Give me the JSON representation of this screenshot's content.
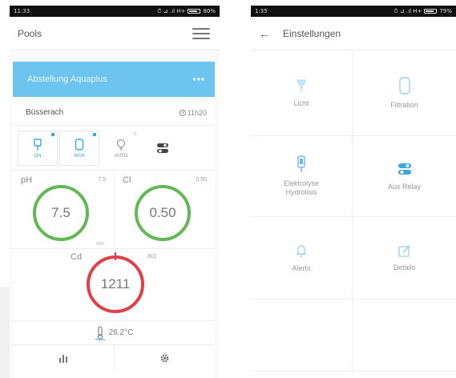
{
  "left_screen": {
    "status_bar": {
      "time": "11:33",
      "right": "⏱ ⊿ .ıl H+",
      "battery": "80%"
    },
    "app_bar": {
      "title": "Pools"
    },
    "banner": {
      "title": "Abstellung Aquaplus",
      "menu": "•••"
    },
    "pool": {
      "name": "Büsserach",
      "time": "11h20"
    },
    "toggles": [
      {
        "name": "light",
        "label": "ON",
        "active": true
      },
      {
        "name": "filtration",
        "label": "MAN",
        "active": true
      },
      {
        "name": "bulb",
        "label": "AUTO",
        "active": false,
        "indicator": "0"
      },
      {
        "name": "switch",
        "label": "",
        "active": false
      }
    ],
    "gauges": [
      {
        "name": "pH",
        "setpoint": "7.5",
        "value": "7.5",
        "sub": "OFF",
        "color": "#62b854"
      },
      {
        "name": "Cl",
        "setpoint": "0.50",
        "value": "0.50",
        "sub": "",
        "color": "#62b854"
      }
    ],
    "cd": {
      "name": "Cd",
      "setpoint": "801",
      "value": "1211",
      "color": "#e0404a"
    },
    "temperature": "26.2°C"
  },
  "right_screen": {
    "status_bar": {
      "time": "1:35",
      "right": "⏱ ⊿ .ıl H+",
      "battery": "79%"
    },
    "app_bar": {
      "back": "←",
      "title": "Einstellungen"
    },
    "menu": [
      {
        "id": "licht",
        "label": "Licht",
        "icon": "bulb-icon"
      },
      {
        "id": "filtration",
        "label": "Filtration",
        "icon": "filter-icon"
      },
      {
        "id": "elektrolyse",
        "label": "Elektrolyse\nHydrolisis",
        "icon": "probe-icon"
      },
      {
        "id": "aux",
        "label": "Aux Relay",
        "icon": "toggle-icon"
      },
      {
        "id": "alerts",
        "label": "Alerts",
        "icon": "bell-icon"
      },
      {
        "id": "details",
        "label": "Details",
        "icon": "edit-icon"
      }
    ]
  },
  "colors": {
    "accent": "#3ba8dd",
    "banner": "#6cc4ef",
    "ok": "#62b854",
    "alert": "#e0404a"
  }
}
